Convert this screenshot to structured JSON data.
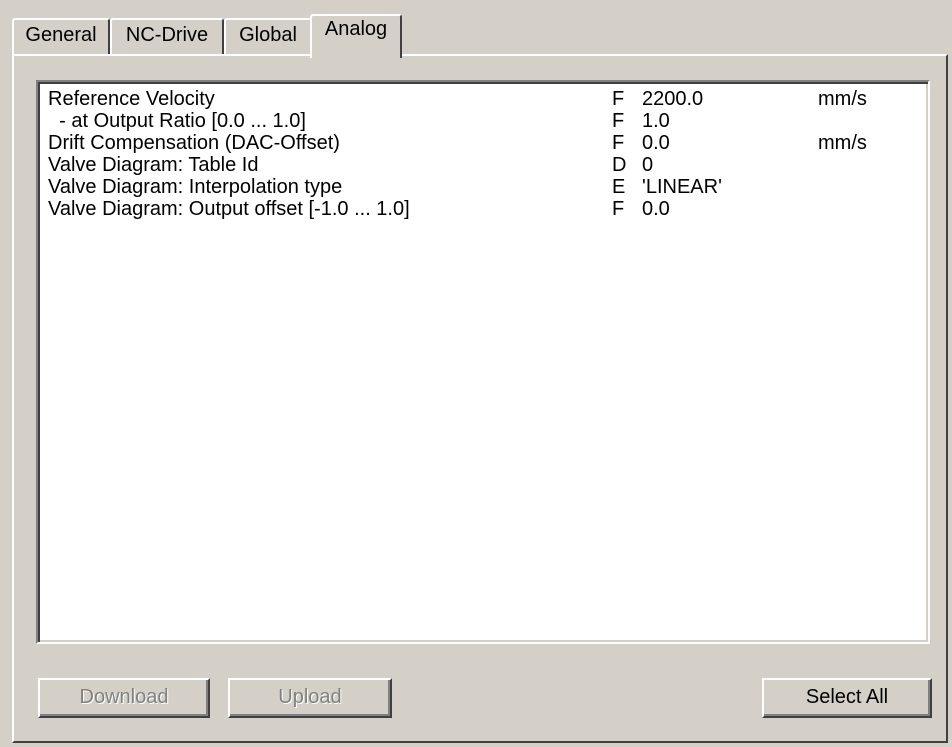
{
  "tabs": [
    {
      "label": "General",
      "active": false
    },
    {
      "label": "NC-Drive",
      "active": false
    },
    {
      "label": "Global",
      "active": false
    },
    {
      "label": "Analog",
      "active": true
    }
  ],
  "parameters": [
    {
      "name": "Reference Velocity",
      "type": "F",
      "value": "2200.0",
      "unit": "mm/s"
    },
    {
      "name": "  - at Output Ratio [0.0 ... 1.0]",
      "type": "F",
      "value": "1.0",
      "unit": ""
    },
    {
      "name": "Drift Compensation (DAC-Offset)",
      "type": "F",
      "value": "0.0",
      "unit": "mm/s"
    },
    {
      "name": "Valve Diagram: Table Id",
      "type": "D",
      "value": "0",
      "unit": ""
    },
    {
      "name": "Valve Diagram: Interpolation type",
      "type": "E",
      "value": "'LINEAR'",
      "unit": ""
    },
    {
      "name": "Valve Diagram: Output offset [-1.0 ... 1.0]",
      "type": "F",
      "value": "0.0",
      "unit": ""
    }
  ],
  "buttons": {
    "download": {
      "label": "Download",
      "enabled": false
    },
    "upload": {
      "label": "Upload",
      "enabled": false
    },
    "select_all": {
      "label": "Select All",
      "enabled": true
    }
  }
}
